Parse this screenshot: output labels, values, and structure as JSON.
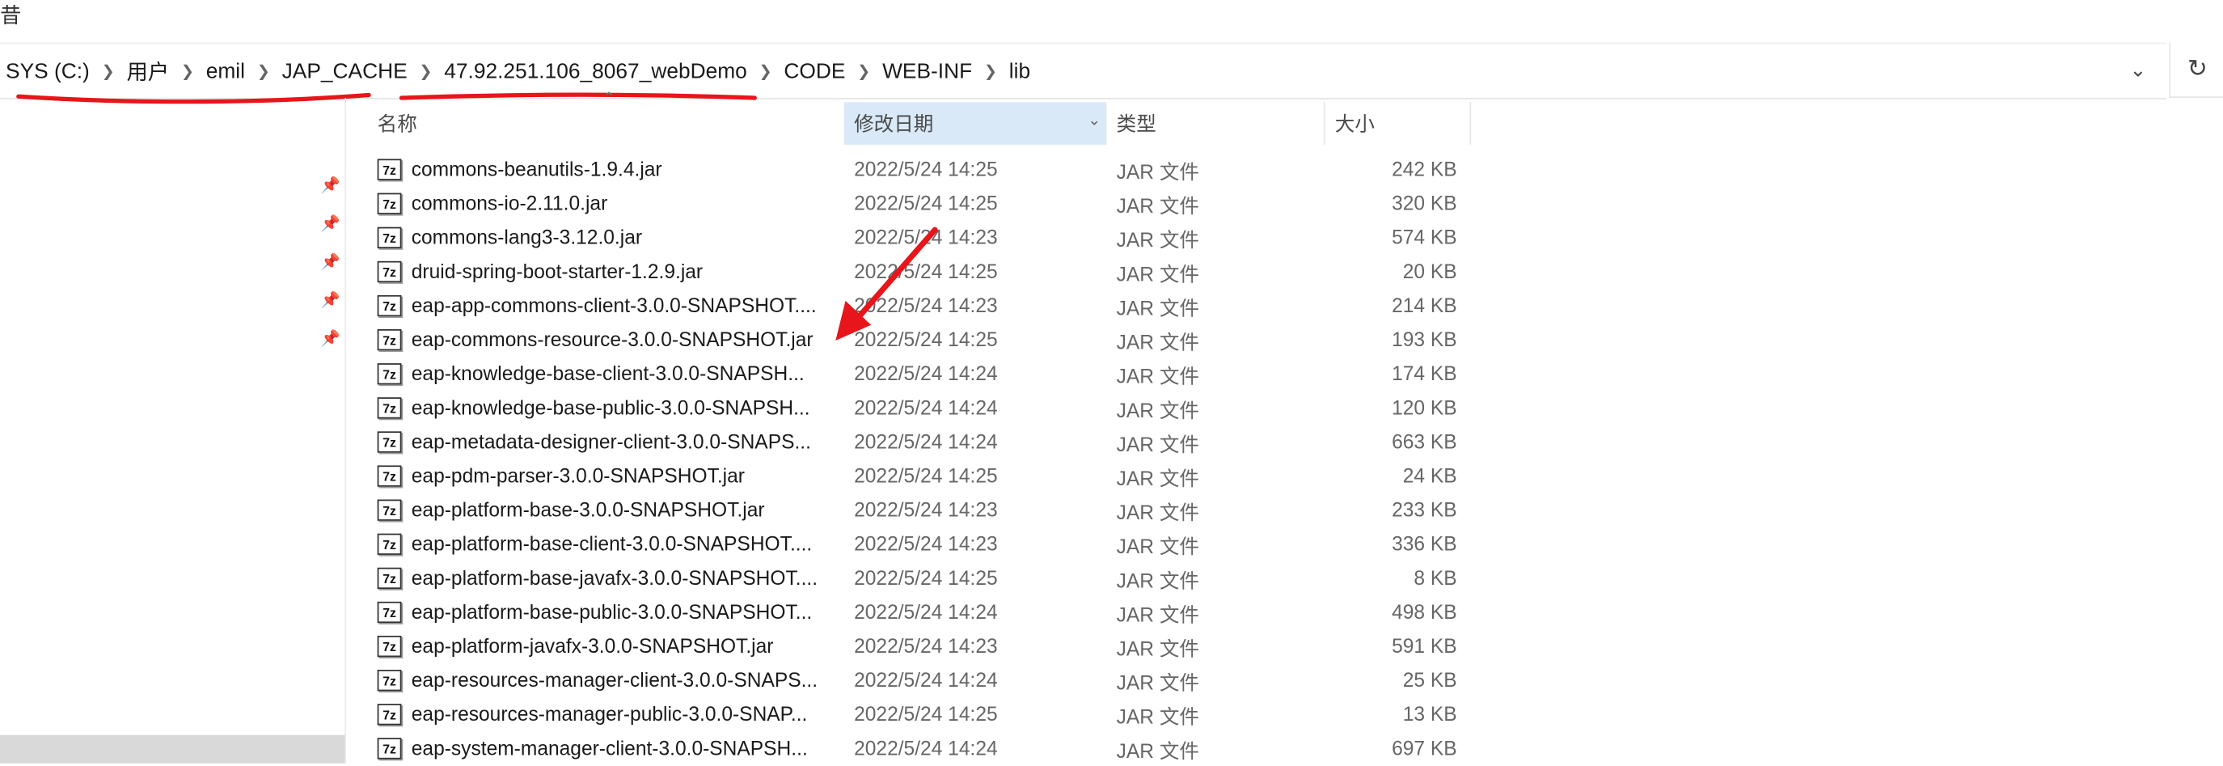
{
  "top_fragment": "昔",
  "breadcrumb": [
    "SYS (C:)",
    "用户",
    "emil",
    "JAP_CACHE",
    "47.92.251.106_8067_webDemo",
    "CODE",
    "WEB-INF",
    "lib"
  ],
  "icons": {
    "separator": "chevron-right-icon",
    "address_dropdown": "chevron-down-icon",
    "refresh": "refresh-icon",
    "pin": "pin-icon",
    "file": "7z-archive-icon",
    "annotation": "red-arrow-annotation"
  },
  "columns": {
    "name": "名称",
    "date": "修改日期",
    "type": "类型",
    "size": "大小"
  },
  "files": [
    {
      "name": "commons-beanutils-1.9.4.jar",
      "date": "2022/5/24 14:25",
      "type": "JAR 文件",
      "size": "242 KB"
    },
    {
      "name": "commons-io-2.11.0.jar",
      "date": "2022/5/24 14:25",
      "type": "JAR 文件",
      "size": "320 KB"
    },
    {
      "name": "commons-lang3-3.12.0.jar",
      "date": "2022/5/24 14:23",
      "type": "JAR 文件",
      "size": "574 KB"
    },
    {
      "name": "druid-spring-boot-starter-1.2.9.jar",
      "date": "2022/5/24 14:25",
      "type": "JAR 文件",
      "size": "20 KB"
    },
    {
      "name": "eap-app-commons-client-3.0.0-SNAPSHOT....",
      "date": "2022/5/24 14:23",
      "type": "JAR 文件",
      "size": "214 KB"
    },
    {
      "name": "eap-commons-resource-3.0.0-SNAPSHOT.jar",
      "date": "2022/5/24 14:25",
      "type": "JAR 文件",
      "size": "193 KB"
    },
    {
      "name": "eap-knowledge-base-client-3.0.0-SNAPSH...",
      "date": "2022/5/24 14:24",
      "type": "JAR 文件",
      "size": "174 KB"
    },
    {
      "name": "eap-knowledge-base-public-3.0.0-SNAPSH...",
      "date": "2022/5/24 14:24",
      "type": "JAR 文件",
      "size": "120 KB"
    },
    {
      "name": "eap-metadata-designer-client-3.0.0-SNAPS...",
      "date": "2022/5/24 14:24",
      "type": "JAR 文件",
      "size": "663 KB"
    },
    {
      "name": "eap-pdm-parser-3.0.0-SNAPSHOT.jar",
      "date": "2022/5/24 14:25",
      "type": "JAR 文件",
      "size": "24 KB"
    },
    {
      "name": "eap-platform-base-3.0.0-SNAPSHOT.jar",
      "date": "2022/5/24 14:23",
      "type": "JAR 文件",
      "size": "233 KB"
    },
    {
      "name": "eap-platform-base-client-3.0.0-SNAPSHOT....",
      "date": "2022/5/24 14:23",
      "type": "JAR 文件",
      "size": "336 KB"
    },
    {
      "name": "eap-platform-base-javafx-3.0.0-SNAPSHOT....",
      "date": "2022/5/24 14:25",
      "type": "JAR 文件",
      "size": "8 KB"
    },
    {
      "name": "eap-platform-base-public-3.0.0-SNAPSHOT...",
      "date": "2022/5/24 14:24",
      "type": "JAR 文件",
      "size": "498 KB"
    },
    {
      "name": "eap-platform-javafx-3.0.0-SNAPSHOT.jar",
      "date": "2022/5/24 14:23",
      "type": "JAR 文件",
      "size": "591 KB"
    },
    {
      "name": "eap-resources-manager-client-3.0.0-SNAPS...",
      "date": "2022/5/24 14:24",
      "type": "JAR 文件",
      "size": "25 KB"
    },
    {
      "name": "eap-resources-manager-public-3.0.0-SNAP...",
      "date": "2022/5/24 14:25",
      "type": "JAR 文件",
      "size": "13 KB"
    },
    {
      "name": "eap-system-manager-client-3.0.0-SNAPSH...",
      "date": "2022/5/24 14:24",
      "type": "JAR 文件",
      "size": "697 KB"
    }
  ],
  "colors": {
    "annotation_red": "#e8151b",
    "sorted_header_bg": "#d9e9f8",
    "nav_selected_bg": "#d9d9d9"
  }
}
